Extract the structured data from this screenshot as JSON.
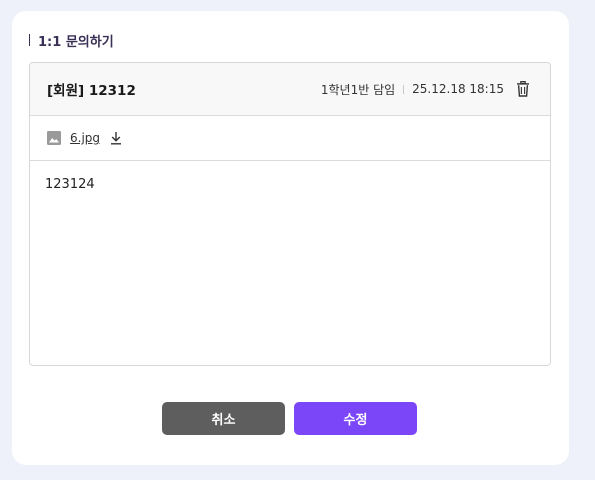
{
  "section": {
    "title": "1:1 문의하기"
  },
  "post": {
    "title": "[회원] 12312",
    "author": "1학년1반 담임",
    "datetime": "25.12.18 18:15",
    "body": "123124"
  },
  "attachment": {
    "filename": "6.jpg"
  },
  "icons": {
    "delete": "trash-icon",
    "image": "image-icon",
    "download": "download-icon"
  },
  "buttons": {
    "cancel_label": "취소",
    "edit_label": "수정"
  },
  "colors": {
    "accent": "#7b46f7",
    "cancel": "#5e5e5e",
    "background": "#eef1f9"
  }
}
